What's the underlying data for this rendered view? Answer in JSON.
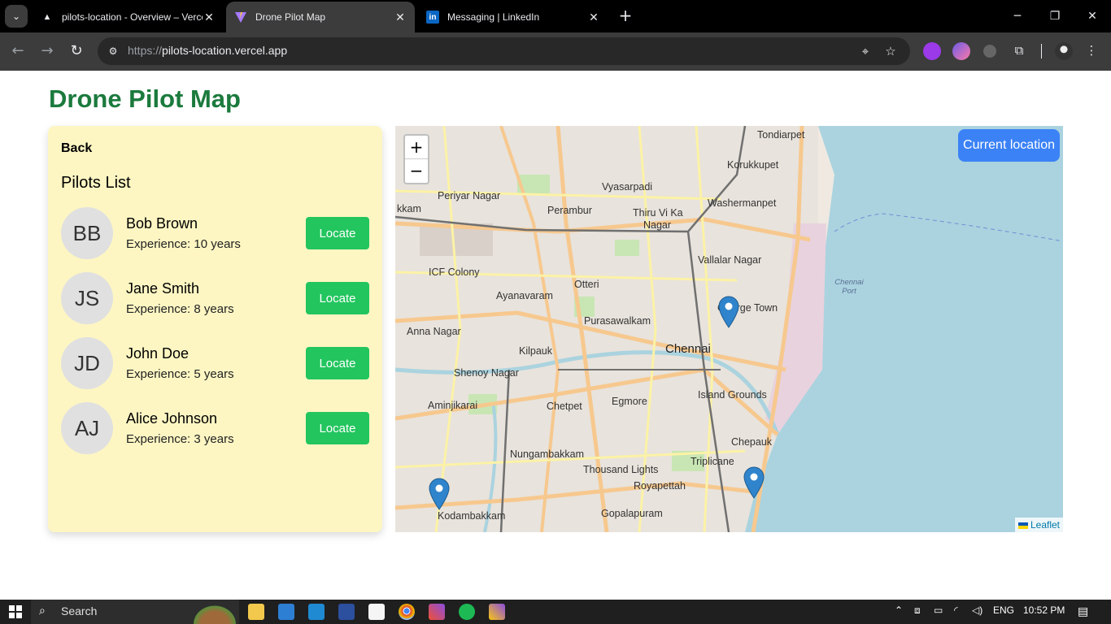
{
  "browser": {
    "tabs": [
      {
        "title": "pilots-location - Overview – Vercel",
        "icon": "vercel-triangle-icon",
        "active": false
      },
      {
        "title": "Drone Pilot Map",
        "icon": "vite-logo-icon",
        "active": true
      },
      {
        "title": "Messaging | LinkedIn",
        "icon": "linkedin-icon",
        "active": false
      }
    ],
    "url_scheme": "https://",
    "url_host": "pilots-location.vercel.app"
  },
  "page": {
    "title": "Drone Pilot Map",
    "back_label": "Back",
    "list_title": "Pilots List",
    "locate_label": "Locate",
    "pilots": [
      {
        "initials": "BB",
        "name": "Bob Brown",
        "experience": "Experience: 10 years"
      },
      {
        "initials": "JS",
        "name": "Jane Smith",
        "experience": "Experience: 8 years"
      },
      {
        "initials": "JD",
        "name": "John Doe",
        "experience": "Experience: 5 years"
      },
      {
        "initials": "AJ",
        "name": "Alice Johnson",
        "experience": "Experience: 3 years"
      }
    ]
  },
  "map": {
    "current_location_label": "Current location",
    "zoom_in": "+",
    "zoom_out": "−",
    "attribution": "Leaflet",
    "labels": {
      "tondiarpet": "Tondiarpet",
      "korukkupet": "Korukkupet",
      "vyasarpadi": "Vyasarpadi",
      "periyar_nagar": "Periyar Nagar",
      "washermanpet": "Washermanpet",
      "perambur": "Perambur",
      "thiru_vi_ka": "Thiru Vi Ka",
      "nagar": "Nagar",
      "kkam": "kkam",
      "icf_colony": "ICF Colony",
      "vallalar_nagar": "Vallalar Nagar",
      "otteri": "Otteri",
      "ayanavaram": "Ayanavaram",
      "george_town": "George Town",
      "purasawalkam": "Purasawalkam",
      "anna_nagar": "Anna Nagar",
      "kilpauk": "Kilpauk",
      "chennai": "Chennai",
      "shenoy_nagar": "Shenoy Nagar",
      "island_grounds": "Island Grounds",
      "aminjikarai": "Aminjikarai",
      "chetpet": "Chetpet",
      "egmore": "Egmore",
      "chepauk": "Chepauk",
      "nungambakkam": "Nungambakkam",
      "triplicane": "Triplicane",
      "thousand_lights": "Thousand Lights",
      "royapettah": "Royapettah",
      "kodambakkam": "Kodambakkam",
      "gopalapuram": "Gopalapuram",
      "chennai_port": "Chennai Port"
    }
  },
  "taskbar": {
    "search_placeholder": "Search",
    "language": "ENG",
    "time": "10:52 PM"
  }
}
